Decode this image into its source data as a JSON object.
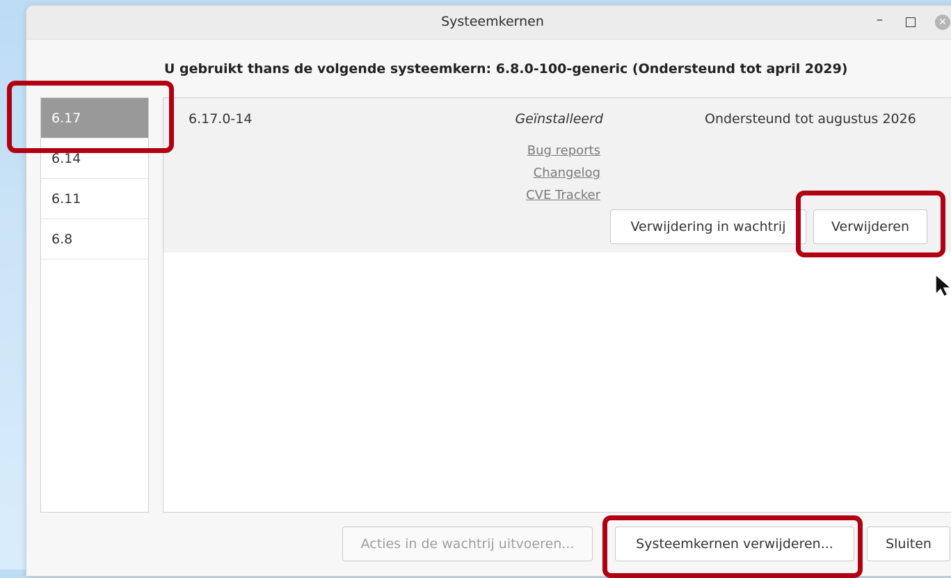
{
  "window": {
    "title": "Systeemkernen",
    "controls": {
      "minimize": "–",
      "close": "✕"
    }
  },
  "current_kernel_text": "U gebruikt thans de volgende systeemkern: 6.8.0-100-generic (Ondersteund tot april 2029)",
  "kernel_list": {
    "items": [
      {
        "label": "6.17",
        "selected": true
      },
      {
        "label": "6.14",
        "selected": false
      },
      {
        "label": "6.11",
        "selected": false
      },
      {
        "label": "6.8",
        "selected": false
      }
    ]
  },
  "kernel_detail": {
    "version": "6.17.0-14",
    "status": "Geïnstalleerd",
    "support": "Ondersteund tot augustus 2026",
    "links": {
      "bug_reports": "Bug reports",
      "changelog": "Changelog",
      "cve_tracker": "CVE Tracker"
    },
    "queue_remove_label": "Verwijdering in wachtrij",
    "remove_label": "Verwijderen"
  },
  "footer": {
    "apply_queue_label": "Acties in de wachtrij uitvoeren...",
    "remove_kernels_label": "Systeemkernen verwijderen...",
    "close_label": "Sluiten"
  },
  "colors": {
    "highlight": "#b00012",
    "selected_row": "#999999",
    "link": "#7a7a7a"
  }
}
